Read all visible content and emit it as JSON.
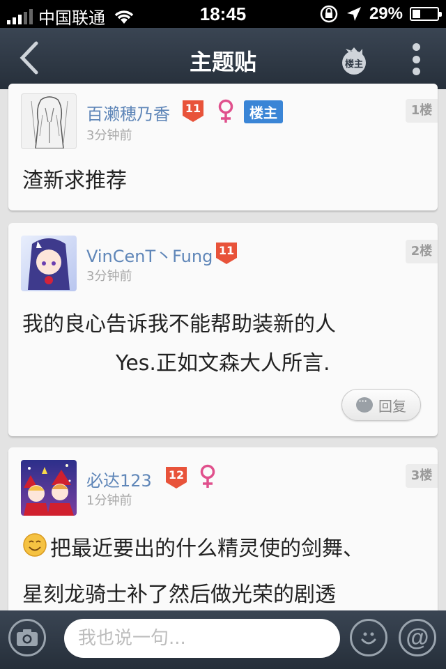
{
  "status_bar": {
    "carrier": "中国联通",
    "time": "18:45",
    "battery": "29%",
    "battery_level": 0.29
  },
  "nav": {
    "title": "主题贴",
    "owner_label": "楼主"
  },
  "posts": [
    {
      "username": "百濑穂乃香",
      "level": "11",
      "is_owner": true,
      "owner_badge": "楼主",
      "time": "3分钟前",
      "floor": "1楼",
      "lines": [
        "渣新求推荐"
      ]
    },
    {
      "username": "VinCenT丶Fung",
      "level": "11",
      "time": "3分钟前",
      "floor": "2楼",
      "lines": [
        "我的良心告诉我不能帮助装新的人",
        "Yes.正如文森大人所言."
      ],
      "reply_label": "回复"
    },
    {
      "username": "必达123",
      "level": "12",
      "time": "1分钟前",
      "floor": "3楼",
      "lines": [
        "把最近要出的什么精灵使的剑舞、",
        "星刻龙骑士补了然后做光荣的剧透"
      ]
    }
  ],
  "bottom_bar": {
    "input_placeholder": "我也说一句..."
  },
  "colors": {
    "nav_bg": "#2f3945",
    "username": "#5f86b8",
    "level_badge": "#e8533a",
    "female": "#e0508c",
    "owner_badge": "#3a85d6"
  }
}
